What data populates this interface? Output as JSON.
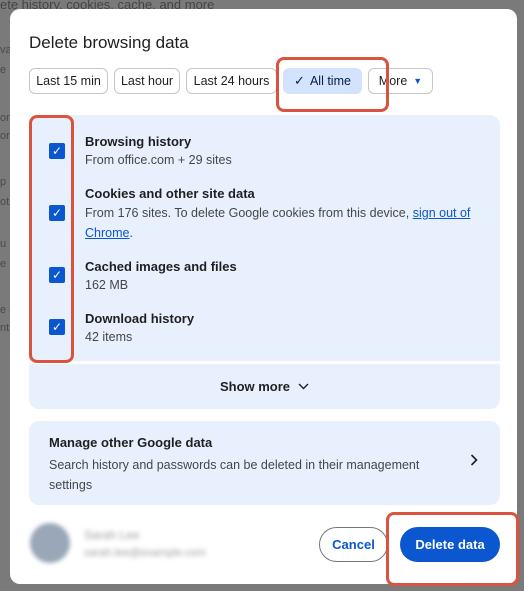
{
  "background": {
    "top_text": "ete history, cookies, cache, and more",
    "edge_fragments": [
      "va",
      "e",
      "ord",
      "ord",
      "p",
      "ot",
      "u",
      "e",
      "e s",
      "nt"
    ]
  },
  "dialog": {
    "title": "Delete browsing data",
    "time_ranges": [
      {
        "label": "Last 15 min",
        "selected": false
      },
      {
        "label": "Last hour",
        "selected": false
      },
      {
        "label": "Last 24 hours",
        "selected": false
      },
      {
        "label": "All time",
        "selected": true
      },
      {
        "label": "More",
        "selected": false
      }
    ],
    "check_mark": "✓",
    "items": [
      {
        "title": "Browsing history",
        "subtitle": "From office.com + 29 sites",
        "checked": true
      },
      {
        "title": "Cookies and other site data",
        "subtitle": "From 176 sites. To delete Google cookies from this device, ",
        "link": "sign out of Chrome",
        "suffix": ".",
        "checked": true
      },
      {
        "title": "Cached images and files",
        "subtitle": "162 MB",
        "checked": true
      },
      {
        "title": "Download history",
        "subtitle": "42 items",
        "checked": true
      }
    ],
    "show_more": "Show more",
    "manage": {
      "title": "Manage other Google data",
      "subtitle": "Search history and passwords can be deleted in their management settings"
    },
    "account": {
      "name": "Sarah Lee",
      "email": "sarah.lee@example.com"
    },
    "cancel_label": "Cancel",
    "delete_label": "Delete data"
  },
  "colors": {
    "accent": "#0b57d0",
    "panel": "#e8f0fe",
    "selected_chip": "#d3e3fd",
    "highlight": "#d9533e"
  }
}
